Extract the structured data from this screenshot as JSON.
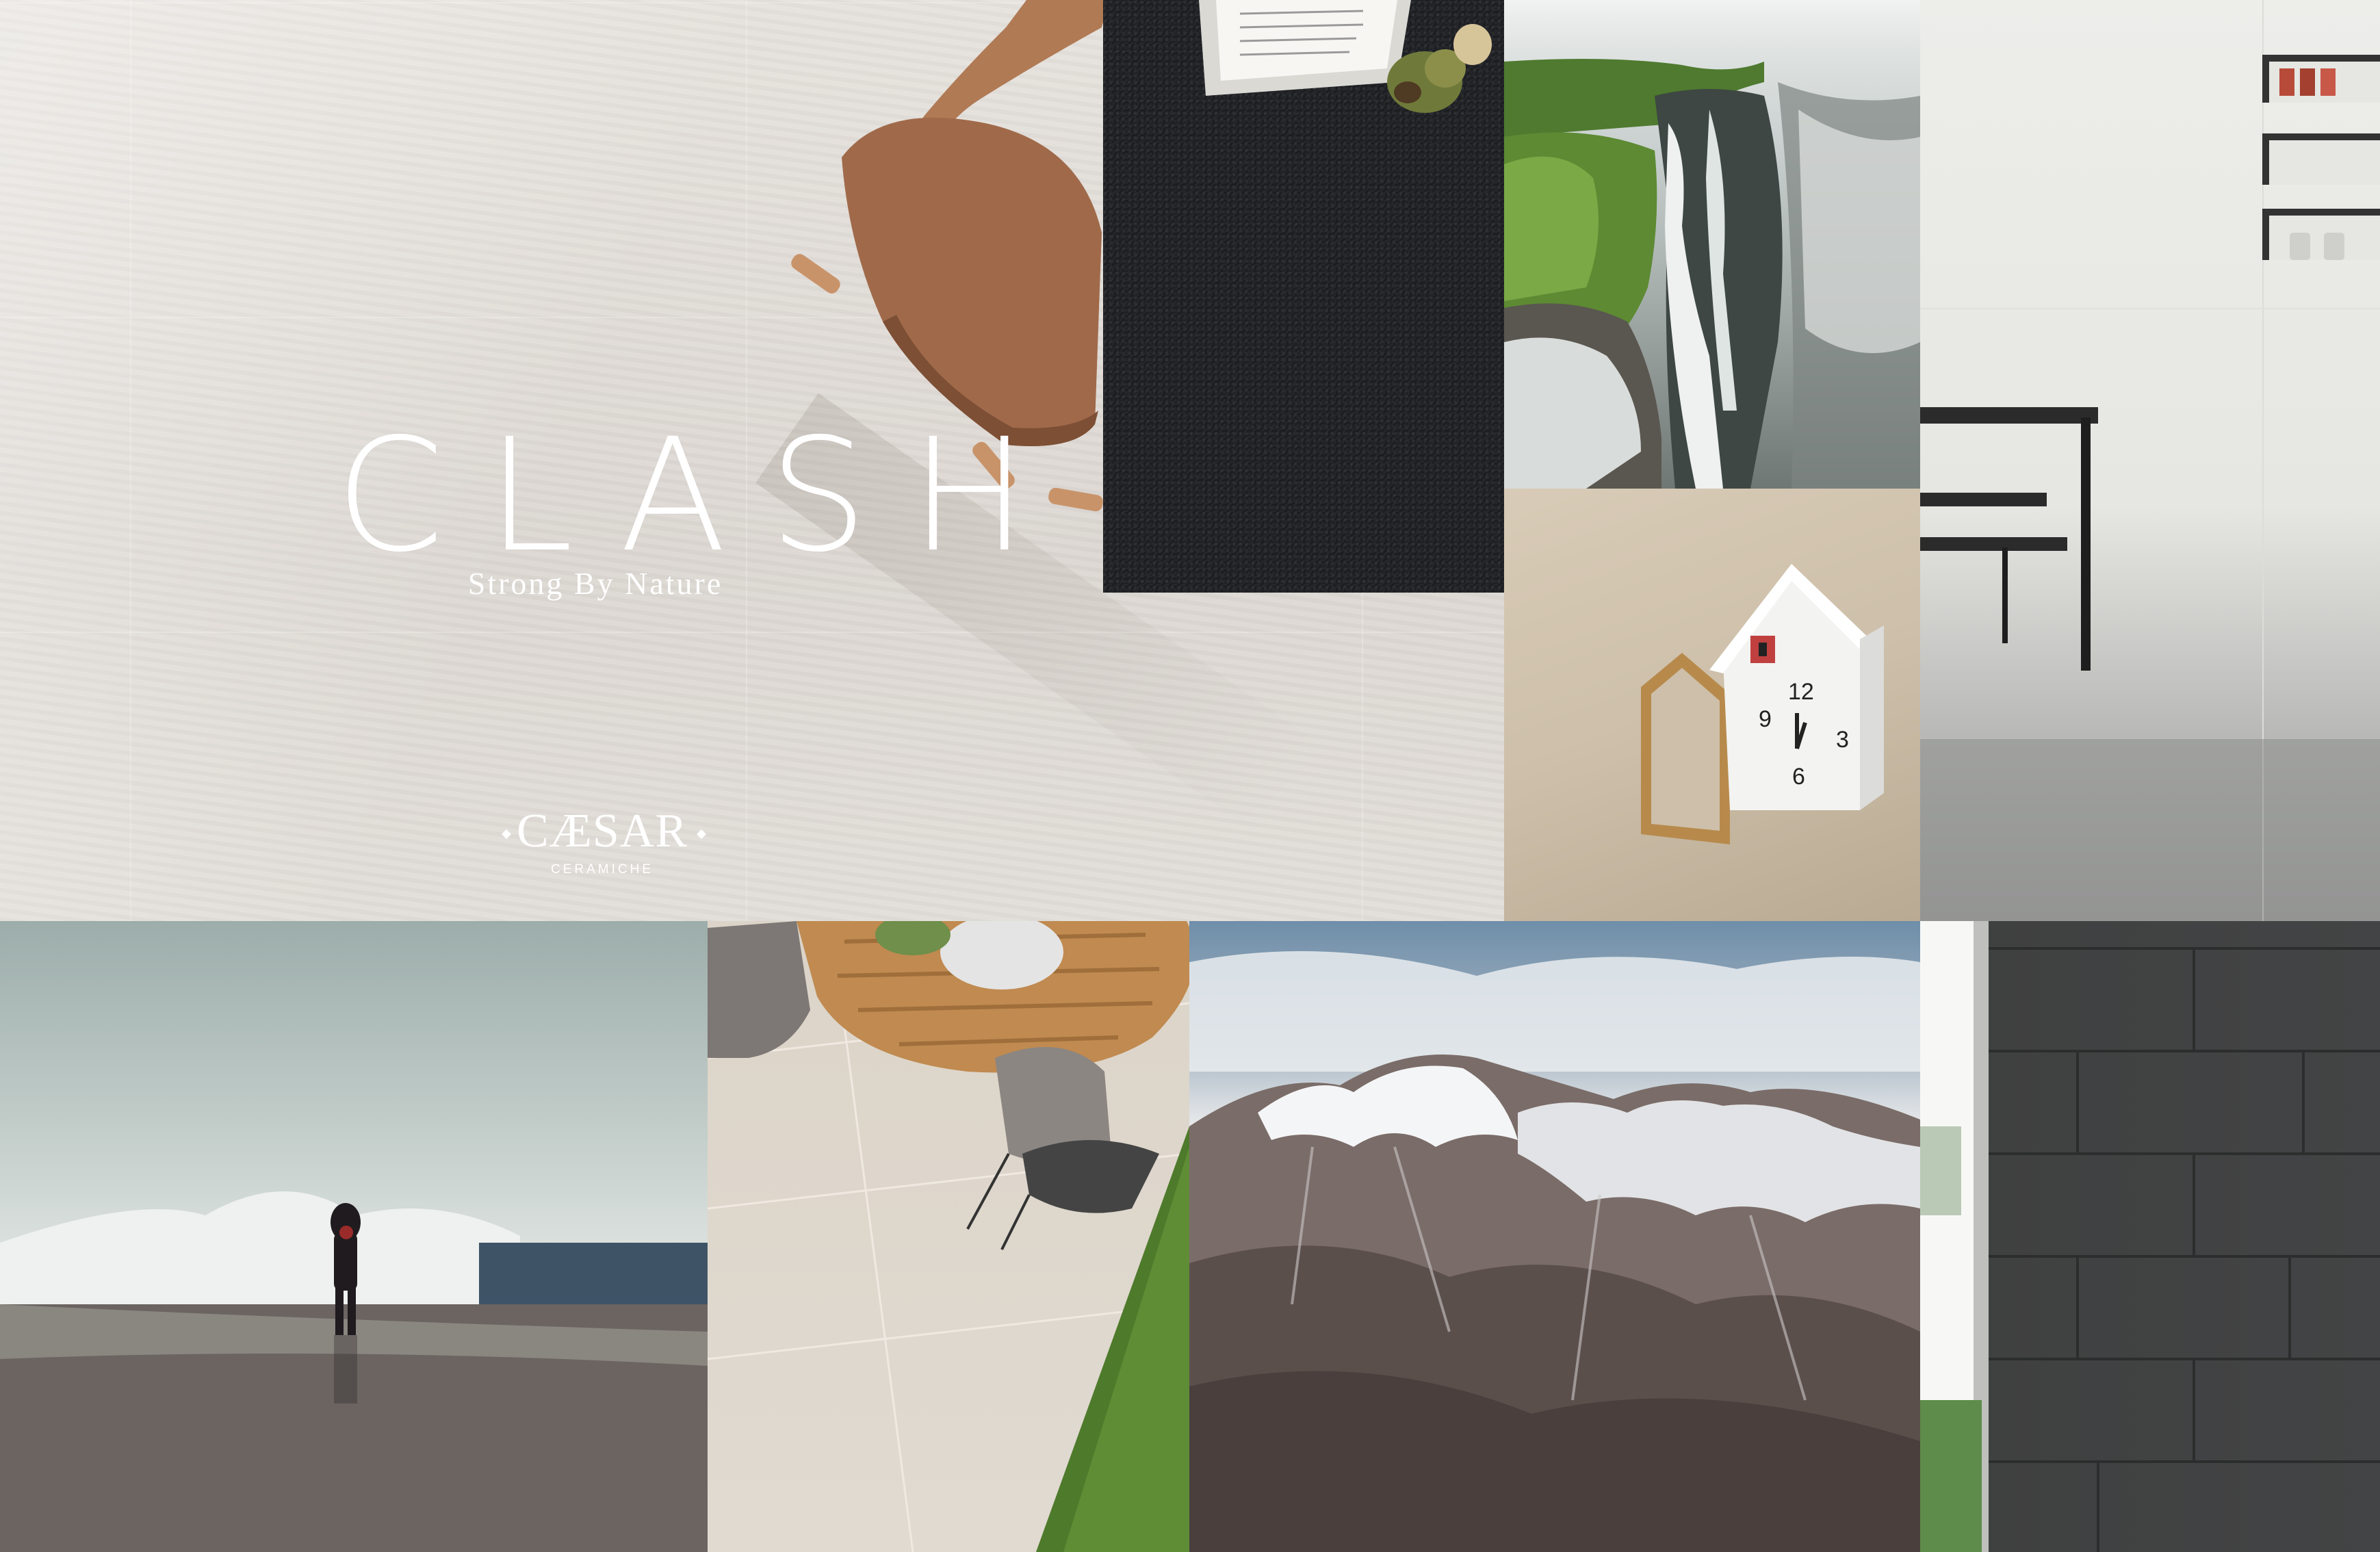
{
  "brand": {
    "title": "CLASH",
    "tagline": "Strong By Nature",
    "logo_wordmark": "CÆSAR",
    "logo_sub": "CERAMICHE"
  },
  "clock": {
    "n12": "12",
    "n3": "3",
    "n6": "6",
    "n9": "9"
  },
  "colors": {
    "hero_stone": "#e0dbd6",
    "carpet": "#202226",
    "slate": "#434445",
    "chair": "#a06a4a",
    "grass": "#4e7a2b"
  }
}
